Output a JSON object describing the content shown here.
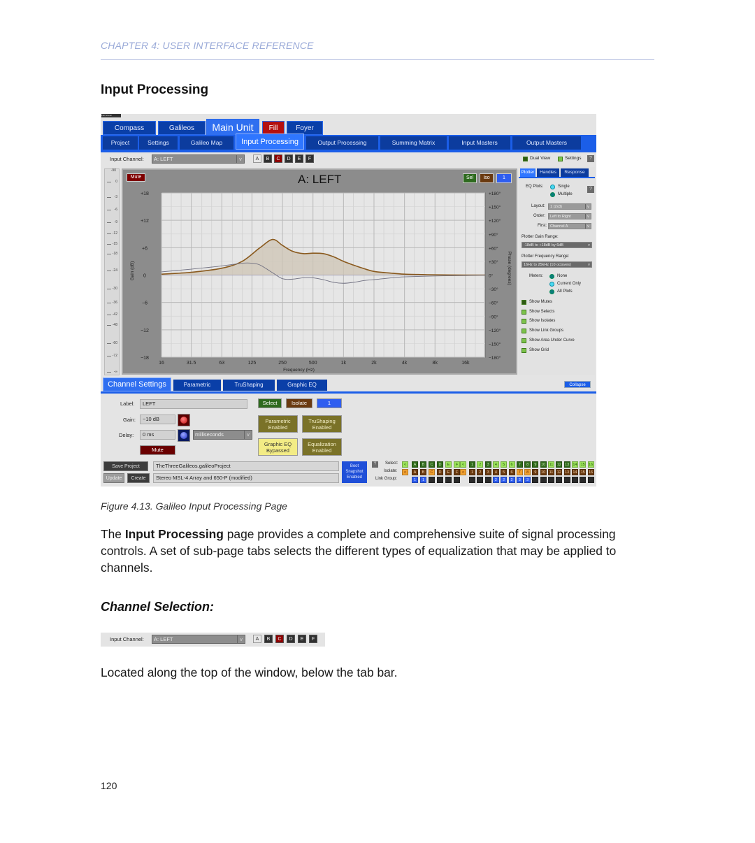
{
  "header": {
    "chapter": "CHAPTER 4: USER INTERFACE REFERENCE",
    "section_title": "Input Processing"
  },
  "figure": {
    "caption": "Figure 4.13. Galileo Input Processing Page"
  },
  "body": {
    "para1_pre": "The ",
    "para1_bold": "Input Processing",
    "para1_post": " page provides a complete and comprehensive suite of signal processing controls. A set of sub-page tabs selects the different types of equalization that may be applied to channels.",
    "subsection_title": "Channel Selection:",
    "para2": "Located along the top of the window, below the tab bar."
  },
  "page_number": "120",
  "app": {
    "full_screen_label": "Full Screen",
    "unit_tabs": [
      {
        "label": "Compass",
        "state": "normal"
      },
      {
        "label": "Galileos",
        "state": "normal"
      },
      {
        "label": "Main Unit",
        "state": "active"
      },
      {
        "label": "Fill",
        "state": "alert"
      },
      {
        "label": "Foyer",
        "state": "normal"
      }
    ],
    "page_tabs": [
      {
        "label": "Project"
      },
      {
        "label": "Settings"
      },
      {
        "label": "Galileo Map"
      },
      {
        "label": "Input Processing",
        "active": true
      },
      {
        "label": "Output Processing"
      },
      {
        "label": "Summing Matrix"
      },
      {
        "label": "Input Masters"
      },
      {
        "label": "Output Masters"
      }
    ],
    "input_channel": {
      "label": "Input Channel:",
      "value": "A: LEFT",
      "arrow": "v",
      "channels": [
        "A",
        "B",
        "C",
        "D",
        "E",
        "F"
      ],
      "selected": "A",
      "alert": "C"
    },
    "top_right": {
      "dual_view": "Dual View",
      "settings": "Settings",
      "help": "?"
    },
    "meter": {
      "top_label": "-90",
      "ticks": [
        "0",
        "-3",
        "-6",
        "-9",
        "-12",
        "-15",
        "-18",
        "-24",
        "-30",
        "-36",
        "-42",
        "-48",
        "-60",
        "-72",
        "-∞"
      ]
    },
    "plot_panel": {
      "mute": "Mute",
      "title": "A: LEFT",
      "sel": "Sel",
      "iso": "Iso",
      "link": "1"
    },
    "side_panel": {
      "tabs": [
        "Plotter",
        "Handles",
        "Response"
      ],
      "active_tab": "Plotter",
      "eq_plots_label": "EQ Plots:",
      "eq_plots_options": [
        "Single",
        "Multiple"
      ],
      "eq_plots_selected": "Single",
      "layout_label": "Layout:",
      "layout_value": "1 (2x3)",
      "order_label": "Order:",
      "order_value": "Left to Right",
      "first_label": "First:",
      "first_value": "Channel A",
      "gain_range_label": "Plotter Gain Range:",
      "gain_range_value": "-18dB to +18dB by 6dB",
      "freq_range_label": "Plotter Frequency Range:",
      "freq_range_value": "16Hz to 25kHz (10 octaves)",
      "meters_label": "Meters:",
      "meters_options": [
        "None",
        "Current Only",
        "All Plots"
      ],
      "meters_selected": "Current Only",
      "checkboxes": [
        {
          "label": "Show Mutes",
          "style": "dark"
        },
        {
          "label": "Show Selects",
          "style": "checked"
        },
        {
          "label": "Show Isolates",
          "style": "checked"
        },
        {
          "label": "Show Link Groups",
          "style": "checked"
        },
        {
          "label": "Show Area Under Curve",
          "style": "checked"
        },
        {
          "label": "Show Grid",
          "style": "checked"
        }
      ],
      "help": "?",
      "arrow": "v"
    },
    "lower_tabs": [
      {
        "label": "Channel Settings",
        "active": true
      },
      {
        "label": "Parametric"
      },
      {
        "label": "TruShaping"
      },
      {
        "label": "Graphic EQ"
      }
    ],
    "collapse": "Collapse",
    "channel_settings": {
      "label_label": "Label:",
      "label_value": "LEFT",
      "gain_label": "Gain:",
      "gain_value": "−10 dB",
      "delay_label": "Delay:",
      "delay_value": "0 ms",
      "delay_units": "milliseconds",
      "mute": "Mute",
      "select": "Select",
      "isolate": "Isolate",
      "link": "1",
      "parametric_l1": "Parametric",
      "parametric_l2": "Enabled",
      "trushaping_l1": "TruShaping",
      "trushaping_l2": "Enabled",
      "graphic_l1": "Graphic EQ",
      "graphic_l2": "Bypassed",
      "equalization_l1": "Equalization",
      "equalization_l2": "Enabled"
    },
    "bottom_bar": {
      "save_project": "Save Project",
      "project_name": "TheThreeGalileos.galileoProject",
      "update": "Update",
      "create": "Create",
      "snapshot_name": "Stereo MSL-4 Array and 650-P (modified)",
      "boot_l1": "Boot",
      "boot_l2": "Snapshot",
      "boot_l3": "Enabled",
      "help": "?",
      "select_label": "Select:",
      "isolate_label": "Isolate:",
      "link_group_label": "Link Group:",
      "all_btn": "<",
      "letters": [
        "A",
        "B",
        "C",
        "D",
        "E",
        "F"
      ],
      "numbers": [
        "1",
        "2",
        "3",
        "4",
        "5",
        "6",
        "7",
        "8",
        "9",
        "10",
        "11",
        "12",
        "13",
        "14",
        "15",
        "16"
      ],
      "select_letters_state": [
        "dark",
        "dark",
        "dark",
        "dark",
        "light",
        "light"
      ],
      "select_numbers_state": [
        "dark",
        "light",
        "dark",
        "light",
        "light",
        "light",
        "dark",
        "dark",
        "dark",
        "dark",
        "light",
        "dark",
        "dark",
        "light",
        "light",
        "light"
      ],
      "isolate_letters_state": [
        "brown",
        "brown",
        "orange",
        "brown",
        "brown",
        "brown"
      ],
      "isolate_numbers_state": [
        "brown",
        "brown",
        "brown",
        "brown",
        "brown",
        "brown",
        "orange",
        "orange",
        "brown",
        "brown",
        "brown",
        "brown",
        "brown",
        "brown",
        "brown",
        "brown"
      ],
      "link_letters": [
        "1",
        "1",
        "",
        "",
        "",
        ""
      ],
      "link_numbers": [
        "",
        "",
        "",
        "2",
        "2",
        "2",
        "3",
        "3",
        "",
        "",
        "",
        "",
        "",
        "",
        "",
        ""
      ]
    }
  },
  "chart_data": {
    "type": "line",
    "title": "A: LEFT",
    "xlabel": "Frequency (Hz)",
    "ylabel": "Gain (dB)",
    "y2label": "Phase (degrees)",
    "x_scale": "log",
    "xlim": [
      16,
      25000
    ],
    "ylim": [
      -18,
      18
    ],
    "y2lim": [
      -180,
      180
    ],
    "x_ticks": [
      "16",
      "31.5",
      "63",
      "125",
      "250",
      "500",
      "1k",
      "2k",
      "4k",
      "8k",
      "16k"
    ],
    "x_tick_values": [
      16,
      31.5,
      63,
      125,
      250,
      500,
      1000,
      2000,
      4000,
      8000,
      16000
    ],
    "y_ticks": [
      "+18",
      "+12",
      "+6",
      "0",
      "−6",
      "−12",
      "−18"
    ],
    "y_tick_values": [
      18,
      12,
      6,
      0,
      -6,
      -12,
      -18
    ],
    "y2_ticks": [
      "+180°",
      "+150°",
      "+120°",
      "+90°",
      "+60°",
      "+30°",
      "0°",
      "−30°",
      "−60°",
      "−90°",
      "−120°",
      "−150°",
      "−180°"
    ],
    "grid": true,
    "series": [
      {
        "name": "Gain",
        "color": "#8a5a1e",
        "fill": true,
        "x": [
          16,
          31.5,
          63,
          100,
          150,
          200,
          250,
          315,
          400,
          500,
          630,
          800,
          1000,
          1250,
          1600,
          2000,
          3000,
          4000,
          6000,
          8000,
          16000,
          25000
        ],
        "y": [
          0.2,
          0.6,
          1.5,
          3.0,
          6.0,
          7.8,
          6.5,
          5.2,
          4.7,
          4.8,
          4.7,
          4.0,
          3.0,
          2.2,
          1.4,
          0.8,
          0.4,
          0.2,
          0.1,
          0.05,
          0,
          0
        ]
      },
      {
        "name": "Phase",
        "color": "#6f6f80",
        "axis": "y2",
        "x": [
          16,
          31.5,
          63,
          100,
          125,
          150,
          200,
          250,
          315,
          400,
          500,
          630,
          800,
          1000,
          1250,
          1600,
          2000,
          3000,
          4000,
          8000,
          16000,
          25000
        ],
        "y": [
          7,
          13,
          20,
          26,
          26,
          22,
          5,
          -8,
          -9,
          -6,
          -6,
          -10,
          -16,
          -18,
          -16,
          -12,
          -10,
          -6,
          -4,
          -2,
          -1,
          0
        ]
      }
    ]
  }
}
